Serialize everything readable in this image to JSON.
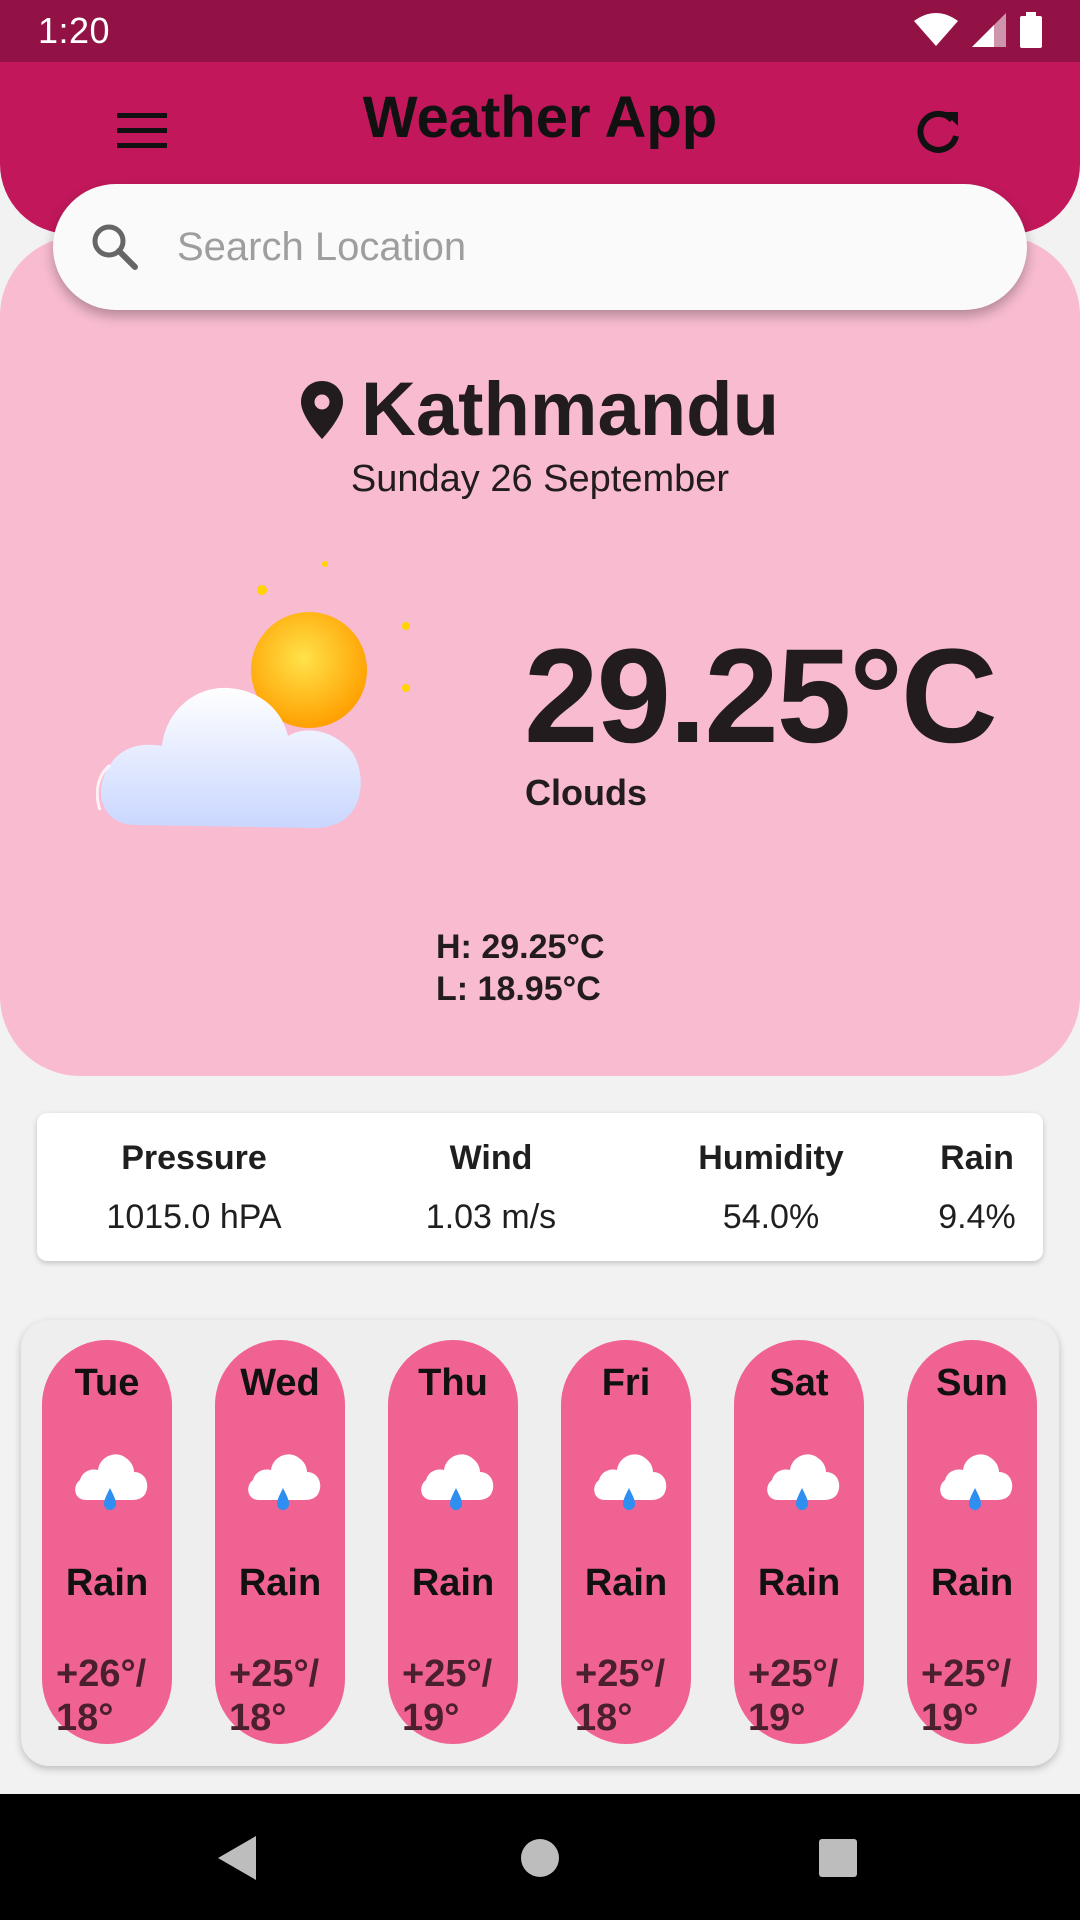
{
  "status_bar": {
    "time": "1:20"
  },
  "app_bar": {
    "title": "Weather App",
    "menu_icon": "menu-icon",
    "refresh_icon": "refresh-icon"
  },
  "search": {
    "placeholder": "Search Location",
    "value": ""
  },
  "current": {
    "city": "Kathmandu",
    "date": "Sunday 26 September",
    "temperature": "29.25°C",
    "condition": "Clouds",
    "high": "H: 29.25°C",
    "low": "L: 18.95°C"
  },
  "stats": [
    {
      "label": "Pressure",
      "value": "1015.0 hPA"
    },
    {
      "label": "Wind",
      "value": "1.03 m/s"
    },
    {
      "label": "Humidity",
      "value": "54.0%"
    },
    {
      "label": "Rain",
      "value": "9.4%"
    }
  ],
  "forecast": [
    {
      "day": "Tue",
      "condition": "Rain",
      "high": "+26°/",
      "low": "18°"
    },
    {
      "day": "Wed",
      "condition": "Rain",
      "high": "+25°/",
      "low": "18°"
    },
    {
      "day": "Thu",
      "condition": "Rain",
      "high": "+25°/",
      "low": "19°"
    },
    {
      "day": "Fri",
      "condition": "Rain",
      "high": "+25°/",
      "low": "18°"
    },
    {
      "day": "Sat",
      "condition": "Rain",
      "high": "+25°/",
      "low": "19°"
    },
    {
      "day": "Sun",
      "condition": "Rain",
      "high": "+25°/",
      "low": "19°"
    }
  ],
  "colors": {
    "status_bar": "#921246",
    "app_bar": "#c2185b",
    "main_card": "#f8bbd0",
    "forecast_pill": "#f06292"
  }
}
